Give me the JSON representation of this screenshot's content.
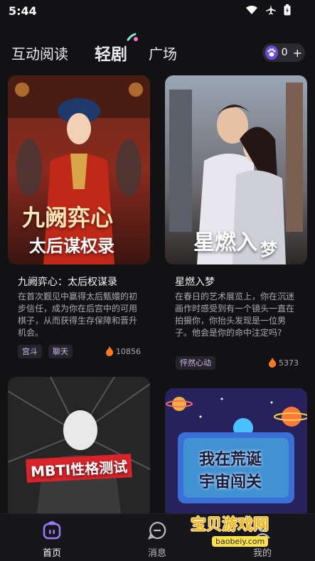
{
  "status_bar": {
    "time": "5:44",
    "icons": [
      "wifi-icon",
      "airplane-icon",
      "battery-icon"
    ]
  },
  "nav": {
    "tabs": [
      {
        "label": "互动阅读",
        "active": false
      },
      {
        "label": "轻剧",
        "active": true
      },
      {
        "label": "广场",
        "active": false
      }
    ],
    "points": {
      "icon": "paw-icon",
      "count": "0",
      "add": "+"
    }
  },
  "cards": [
    {
      "cover_title": "九阙弈心",
      "cover_subtitle": "太后谋权录",
      "title": "九阙弈心：太后权谋录",
      "description": "在首次觐见中赢得太后甄嬛的初步信任，成为你在后宫中的可用棋子，从而获得生存保障和晋升机会。",
      "tags": [
        "宫斗",
        "聊天"
      ],
      "heat": "10856"
    },
    {
      "cover_title": "星燃入",
      "cover_title_2": "梦",
      "title": "星燃入梦",
      "description": "在春日的艺术展览上，你在沉迷画作时感受到有一个镜头一直在拍摄你，你抬头发现是一位男子。他会是你的命中注定吗?",
      "tags": [
        "怦然心动"
      ],
      "heat": "5373"
    },
    {
      "cover_title": "MBTI性格测试"
    },
    {
      "cover_title": "我在荒诞",
      "cover_subtitle": "宇宙闯关"
    }
  ],
  "bottom_nav": [
    {
      "label": "首页",
      "icon": "home-icon",
      "active": true
    },
    {
      "label": "消息",
      "icon": "message-icon",
      "active": false
    },
    {
      "label": "我的",
      "icon": "profile-icon",
      "active": false
    }
  ],
  "watermark": {
    "text": "宝贝游戏网",
    "url": "baobeiy.com"
  },
  "colors": {
    "accent": "#7b5cf0",
    "background": "#121215",
    "tag_text": "#d6b6f0",
    "heat_flame": "#ff7a1a"
  }
}
